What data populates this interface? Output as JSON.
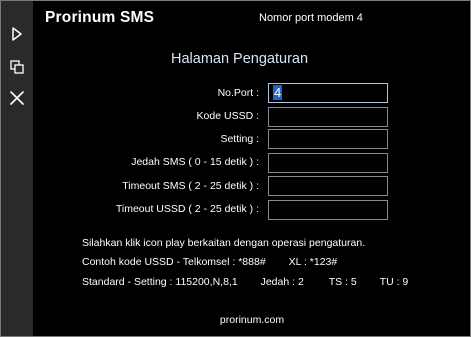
{
  "app": {
    "title": "Prorinum SMS"
  },
  "top_hint": "Nomor port modem 4",
  "sidebar": {
    "buttons": [
      {
        "icon": "play-icon"
      },
      {
        "icon": "copy-icon"
      },
      {
        "icon": "close-icon"
      }
    ]
  },
  "form": {
    "heading": "Halaman Pengaturan",
    "fields": [
      {
        "label": "No.Port :",
        "value": "4"
      },
      {
        "label": "Kode USSD :",
        "value": ""
      },
      {
        "label": "Setting :",
        "value": ""
      },
      {
        "label": "Jedah SMS ( 0 - 15 detik ) :",
        "value": ""
      },
      {
        "label": "Timeout SMS ( 2 - 25 detik ) :",
        "value": ""
      },
      {
        "label": "Timeout USSD ( 2 - 25 detik ) :",
        "value": ""
      }
    ]
  },
  "info": {
    "line1": "Silahkan klik icon play berkaitan dengan operasi pengaturan.",
    "line2_a": "Contoh kode USSD  -  Telkomsel : *888#",
    "line2_b": "XL : *123#",
    "line3_a": "Standard  -  Setting : 115200,N,8,1",
    "line3_b": "Jedah : 2",
    "line3_c": "TS : 5",
    "line3_d": "TU : 9"
  },
  "footer": "prorinum.com",
  "colors": {
    "background": "#000000",
    "sidebar": "#2a2a2a",
    "selection": "#1f66c8",
    "heading": "#d8e4f5"
  }
}
